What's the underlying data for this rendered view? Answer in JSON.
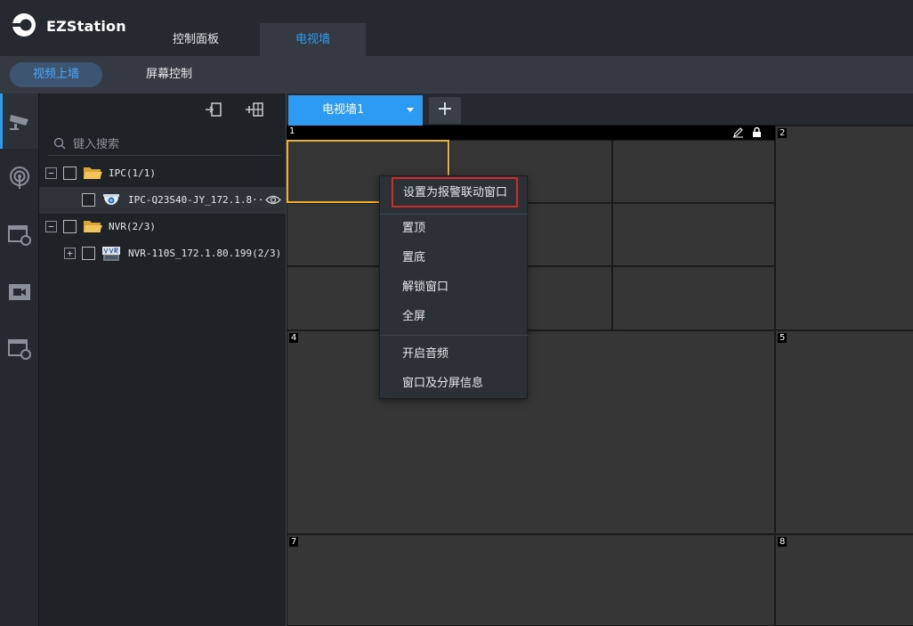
{
  "app": {
    "name": "EZStation"
  },
  "top_tabs": [
    {
      "label": "控制面板",
      "active": false
    },
    {
      "label": "电视墙",
      "active": true
    }
  ],
  "sub_tabs": [
    {
      "label": "视频上墙",
      "active": true
    },
    {
      "label": "屏幕控制",
      "active": false
    }
  ],
  "rail": [
    {
      "icon": "camera-icon",
      "active": true
    },
    {
      "icon": "signal-icon",
      "active": false
    },
    {
      "icon": "screen-refresh-icon",
      "active": false
    },
    {
      "icon": "video-icon",
      "active": false
    },
    {
      "icon": "screen-refresh-icon",
      "active": false
    }
  ],
  "tree": {
    "search_placeholder": "键入搜索",
    "groups": [
      {
        "label": "IPC(1/1)",
        "expanded": true,
        "children": [
          {
            "label": "IPC-Q23S40-JY_172.1.8···",
            "type": "dome-camera",
            "selected": true
          }
        ]
      },
      {
        "label": "NVR(2/3)",
        "expanded": true,
        "children": [
          {
            "label": "NVR-110S_172.1.80.199(2/3)",
            "type": "nvr",
            "selected": false
          }
        ]
      }
    ]
  },
  "wall": {
    "tab_label": "电视墙1",
    "add_label": "+",
    "screens": [
      "1",
      "2",
      "4",
      "5",
      "7",
      "8"
    ]
  },
  "context_menu": {
    "items": [
      "设置为报警联动窗口",
      "置顶",
      "置底",
      "解锁窗口",
      "全屏",
      "开启音频",
      "窗口及分屏信息"
    ],
    "highlighted_index": 0
  },
  "colors": {
    "accent": "#2e9bf3",
    "selection": "#f0b030",
    "highlight_border": "#d02a2a",
    "screen_bg": "#363636"
  }
}
